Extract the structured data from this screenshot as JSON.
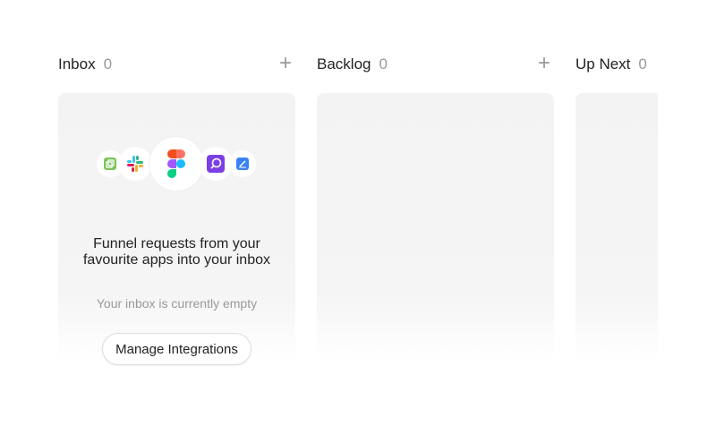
{
  "columns": [
    {
      "title": "Inbox",
      "count": "0"
    },
    {
      "title": "Backlog",
      "count": "0"
    },
    {
      "title": "Up Next",
      "count": "0"
    }
  ],
  "inbox_empty": {
    "icons": [
      "integration-app-icon",
      "slack-icon",
      "figma-icon",
      "purple-app-icon",
      "blue-edit-app-icon"
    ],
    "message": "Funnel requests from your favourite apps into your inbox",
    "subtext": "Your inbox is currently empty",
    "button": "Manage Integrations"
  },
  "add_symbol": "+"
}
